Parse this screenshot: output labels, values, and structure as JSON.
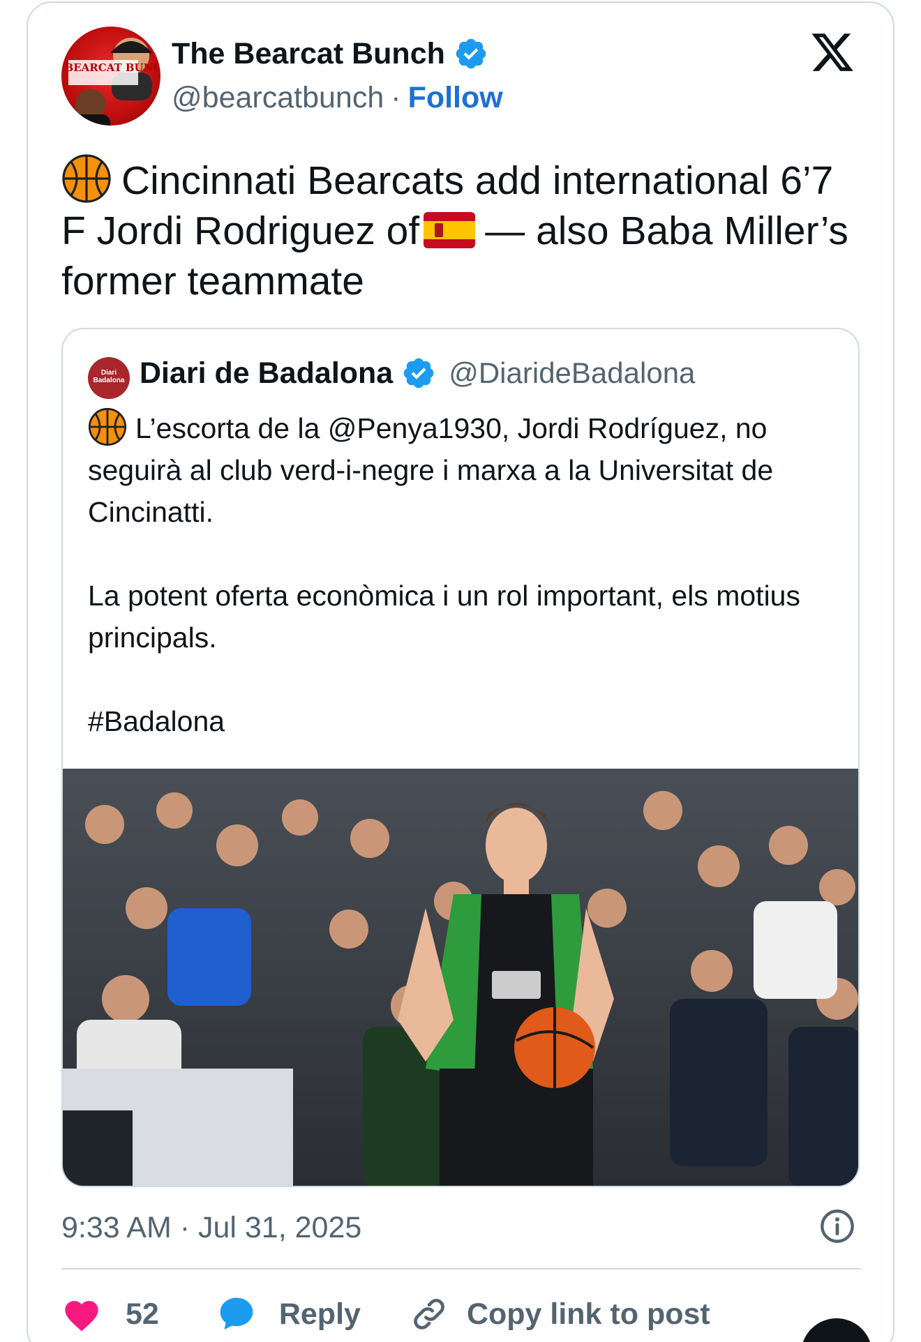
{
  "author": {
    "display_name": "The Bearcat Bunch",
    "handle": "@bearcatbunch",
    "separator": "·",
    "follow_label": "Follow",
    "avatar_text": "THE BEARCAT BUNCH",
    "verified": true
  },
  "post": {
    "text_line_a": "Cincinnati Bearcats add international 6’7 F Jordi Rodriguez of",
    "text_line_b": "— also Baba Miller’s former teammate",
    "lead_emoji": "basketball-emoji",
    "flag_emoji": "spain-flag-emoji"
  },
  "quoted": {
    "display_name": "Diari de Badalona",
    "handle": "@DiarideBadalona",
    "avatar_text": "Diari Badalona",
    "verified": true,
    "paragraph_1": "L’escorta de la @Penya1930, Jordi Rodríguez, no seguirà al club verd-i-negre i marxa a la Universitat de Cincinatti.",
    "paragraph_2": "La potent oferta econòmica i un rol important, els motius principals.",
    "paragraph_3": "#Badalona",
    "lead_emoji": "basketball-emoji"
  },
  "meta": {
    "timestamp": "9:33 AM · Jul 31, 2025"
  },
  "actions": {
    "like_count": "52",
    "reply_label": "Reply",
    "copy_link_label": "Copy link to post"
  },
  "colors": {
    "accent": "#1d9bf0",
    "follow": "#1d6fd6",
    "like": "#f91880",
    "secondary_text": "#536471",
    "border": "#cfd9de"
  }
}
